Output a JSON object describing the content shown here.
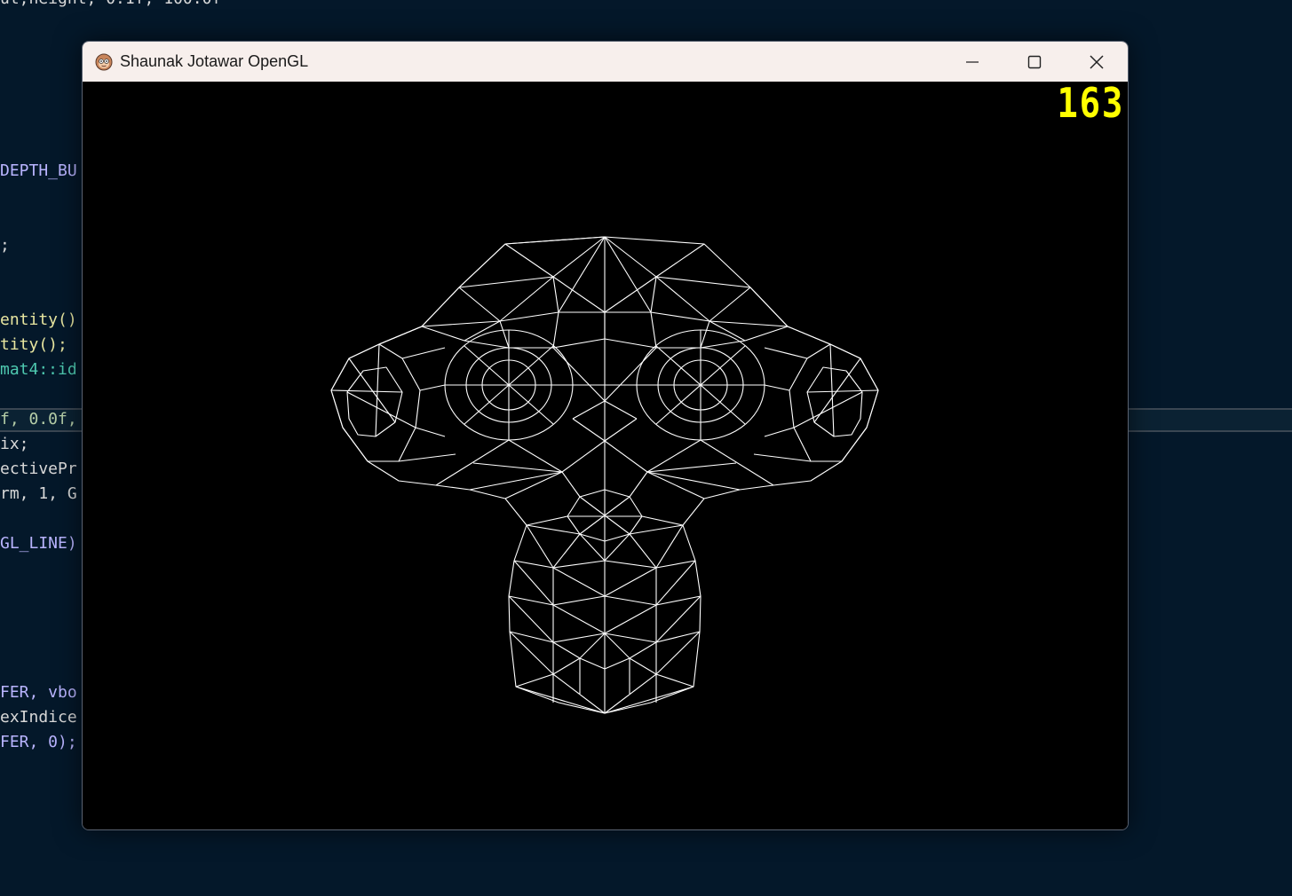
{
  "editor": {
    "lines": [
      {
        "text": "ut,height, 0.1f, 100.0f",
        "color": "#d8d8d8"
      },
      {
        "text": "DEPTH_BU",
        "color": "#b9b4ff"
      },
      {
        "text": ";",
        "color": "#d8d8d8"
      },
      {
        "text": "entity()",
        "color": "#e8e6a0"
      },
      {
        "text": "tity();",
        "color": "#e8e6a0"
      },
      {
        "text": "mat4::id",
        "color": "#4ec9b0"
      },
      {
        "text": "f, 0.0f,",
        "color": "#b5cea8"
      },
      {
        "text": "ix;",
        "color": "#d8d8d8"
      },
      {
        "text": "ectivePr",
        "color": "#d8d8d8"
      },
      {
        "text": "rm, 1, G",
        "color": "#d8d8d8"
      },
      {
        "text": "GL_LINE)",
        "color": "#b9b4ff"
      },
      {
        "text": "FER, vbo",
        "color": "#b9b4ff"
      },
      {
        "text": "exIndice",
        "color": "#d8d8d8"
      },
      {
        "text": "FER, 0);",
        "color": "#b9b4ff"
      }
    ]
  },
  "window": {
    "title": "Shaunak Jotawar OpenGL",
    "app_icon": "monkey-face-icon",
    "controls": {
      "minimize_icon": "minimize-icon",
      "maximize_icon": "maximize-icon",
      "close_icon": "close-icon"
    }
  },
  "viewport": {
    "fps_counter": "163",
    "fps_color": "#ffff00",
    "wireframe_color": "#ffffff",
    "background": "#000000",
    "model_icon": "wireframe-monkey-head"
  }
}
